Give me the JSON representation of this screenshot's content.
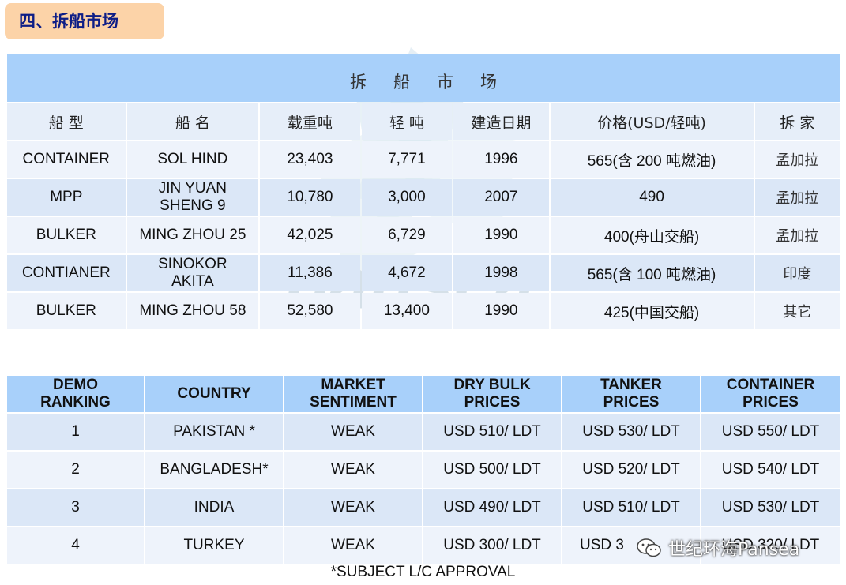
{
  "section_title": "四、拆船市场",
  "watermark_text": "pansea",
  "demolition_table": {
    "title": "拆船市场",
    "headers": [
      "船 型",
      "船 名",
      "载重吨",
      "轻 吨",
      "建造日期",
      "价格(USD/轻吨)",
      "拆 家"
    ],
    "rows": [
      {
        "type": "CONTAINER",
        "name": "SOL HIND",
        "dwt": "23,403",
        "ldt": "7,771",
        "built": "1996",
        "price": "565(含 200 吨燃油)",
        "buyer": "孟加拉"
      },
      {
        "type": "MPP",
        "name": "JIN YUAN SHENG 9",
        "dwt": "10,780",
        "ldt": "3,000",
        "built": "2007",
        "price": "490",
        "buyer": "孟加拉"
      },
      {
        "type": "BULKER",
        "name": "MING ZHOU 25",
        "dwt": "42,025",
        "ldt": "6,729",
        "built": "1990",
        "price": "400(舟山交船)",
        "buyer": "孟加拉"
      },
      {
        "type": "CONTIANER",
        "name": "SINOKOR AKITA",
        "dwt": "11,386",
        "ldt": "4,672",
        "built": "1998",
        "price": "565(含 100 吨燃油)",
        "buyer": "印度"
      },
      {
        "type": "BULKER",
        "name": "MING ZHOU 58",
        "dwt": "52,580",
        "ldt": "13,400",
        "built": "1990",
        "price": "425(中国交船)",
        "buyer": "其它"
      }
    ]
  },
  "ranking_table": {
    "headers": [
      "DEMO RANKING",
      "COUNTRY",
      "MARKET SENTIMENT",
      "DRY BULK PRICES",
      "TANKER PRICES",
      "CONTAINER PRICES"
    ],
    "rows": [
      {
        "rank": "1",
        "country": "PAKISTAN *",
        "sentiment": "WEAK",
        "dry_bulk": "USD 510/ LDT",
        "tanker": "USD 530/ LDT",
        "container": "USD 550/ LDT"
      },
      {
        "rank": "2",
        "country": "BANGLADESH*",
        "sentiment": "WEAK",
        "dry_bulk": "USD 500/ LDT",
        "tanker": "USD 520/ LDT",
        "container": "USD 540/ LDT"
      },
      {
        "rank": "3",
        "country": "INDIA",
        "sentiment": "WEAK",
        "dry_bulk": "USD 490/ LDT",
        "tanker": "USD 510/ LDT",
        "container": "USD 530/ LDT"
      },
      {
        "rank": "4",
        "country": "TURKEY",
        "sentiment": "WEAK",
        "dry_bulk": "USD 300/ LDT",
        "tanker": "USD 3",
        "container": "USD 320/ LDT"
      }
    ]
  },
  "footnote": "*SUBJECT L/C APPROVAL",
  "wechat_label": "世纪环海Pansea"
}
